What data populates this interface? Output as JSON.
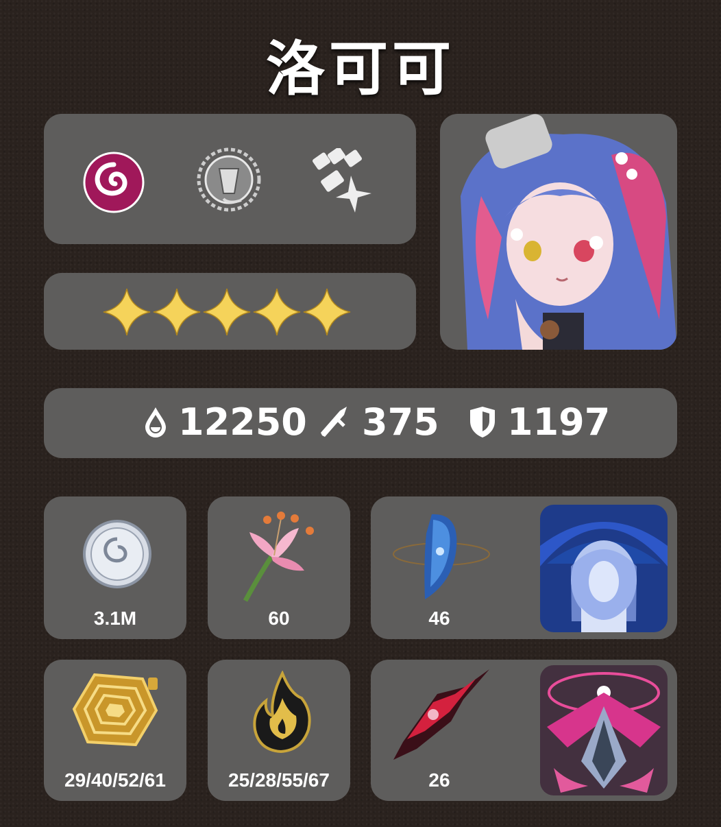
{
  "title": "洛可可",
  "stats": {
    "hp": "12250",
    "atk": "375",
    "def": "1197"
  },
  "rarity_stars": 5,
  "items": {
    "coin_label": "3.1M",
    "lily_label": "60",
    "shell_label": "46",
    "maze_label": "29/40/52/61",
    "flame_label": "25/28/55/67",
    "shard_label": "26"
  },
  "colors": {
    "panel": "#5e5d5c",
    "background": "#2a221e",
    "element_accent": "#a0185a",
    "star": "#f5d35a"
  },
  "icons": [
    "element-spiral-icon",
    "faction-emblem-icon",
    "fist-attack-icon",
    "hp-drop-icon",
    "attack-sword-icon",
    "defense-shield-icon"
  ]
}
